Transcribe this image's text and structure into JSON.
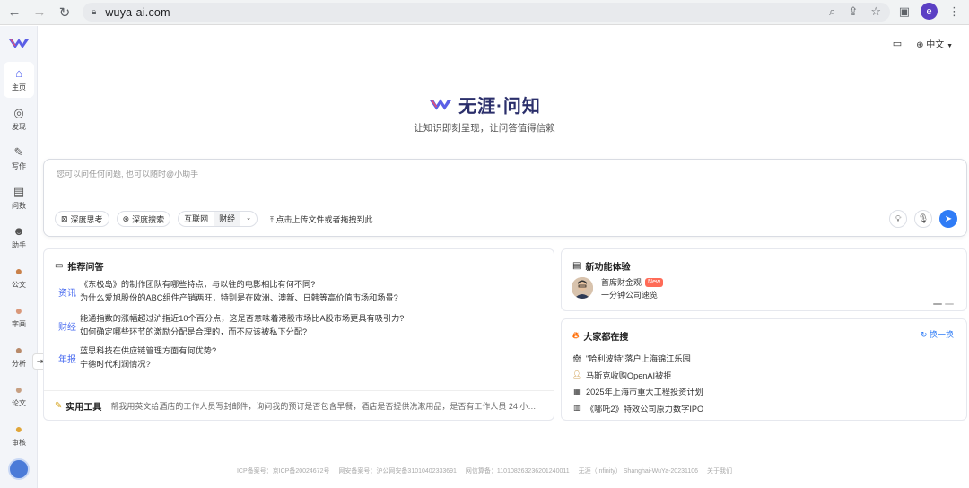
{
  "browser": {
    "url": "wuya-ai.com",
    "profile_initial": "e"
  },
  "sidebar": {
    "items": [
      {
        "label": "主页",
        "icon": "home-icon",
        "glyph": "⌂"
      },
      {
        "label": "发现",
        "icon": "discover-icon",
        "glyph": "◎"
      },
      {
        "label": "写作",
        "icon": "pen-icon",
        "glyph": "✎"
      },
      {
        "label": "问数",
        "icon": "chat-data-icon",
        "glyph": "▤"
      },
      {
        "label": "助手",
        "icon": "robot-icon",
        "glyph": "☻"
      },
      {
        "label": "公文",
        "icon": "doc-avatar-icon",
        "glyph": "●"
      },
      {
        "label": "字画",
        "icon": "art-avatar-icon",
        "glyph": "●"
      },
      {
        "label": "分析",
        "icon": "analysis-avatar-icon",
        "glyph": "●"
      },
      {
        "label": "论文",
        "icon": "paper-avatar-icon",
        "glyph": "●"
      },
      {
        "label": "审核",
        "icon": "review-avatar-icon",
        "glyph": "●"
      }
    ]
  },
  "topbar": {
    "language": "中文"
  },
  "brand": {
    "title": "无涯·问知",
    "subtitle": "让知识即刻呈现，让问答值得信赖"
  },
  "composer": {
    "placeholder": "您可以问任何问题, 也可以随时@小助手",
    "deep_think": "深度思考",
    "deep_search": "深度搜索",
    "source_internet": "互联网",
    "source_finance": "财经",
    "upload_hint": "点击上传文件或者拖拽到此"
  },
  "recommend": {
    "title": "推荐问答",
    "groups": [
      {
        "tag": "资讯",
        "questions": [
          "《东极岛》的制作团队有哪些特点，与以往的电影相比有何不同?",
          "为什么爱旭股份的ABC组件产销两旺，特别是在欧洲、澳新、日韩等高价值市场和场景?"
        ]
      },
      {
        "tag": "财经",
        "questions": [
          "能通指数的涨幅超过沪指近10个百分点，这是否意味着港股市场比A股市场更具有吸引力?",
          "如何确定哪些环节的激励分配是合理的，而不应该被私下分配?"
        ]
      },
      {
        "tag": "年报",
        "questions": [
          "蓝思科技在供应链管理方面有何优势?",
          "宁德时代利润情况?"
        ]
      }
    ],
    "tools_title": "实用工具",
    "tools_text": "帮我用英文给酒店的工作人员写封邮件，询问我的预订是否包含早餐，酒店是否提供洗漱用品，是否有工作人员 24 小时..."
  },
  "features": {
    "title": "新功能体验",
    "name": "首席财金观",
    "badge": "New",
    "desc": "一分钟公司速览"
  },
  "hot": {
    "title": "大家都在搜",
    "refresh": "换一换",
    "items": [
      {
        "text": "\"哈利波特\"落户上海锦江乐园"
      },
      {
        "text": "马斯克收购OpenAI被拒"
      },
      {
        "text": "2025年上海市重大工程投资计划"
      },
      {
        "text": "《哪吒2》特效公司原力数字IPO"
      }
    ]
  },
  "footer": {
    "icp_label": "ICP备案号：",
    "icp_value": "京ICP备20024672号",
    "net_label": "网安备案号：",
    "net_value": "沪公网安备31010402333691",
    "filing_label": "网信算备：",
    "filing_value": "110108263236201240011",
    "company": "无涯（Infinity） Shanghai-WuYa-20231106",
    "about": "关于我们"
  },
  "colors": {
    "accent": "#2f7cf6",
    "brand_text": "#2b2f6b",
    "tag_blue": "#4a6cf0",
    "badge_red": "#ff6b57"
  }
}
